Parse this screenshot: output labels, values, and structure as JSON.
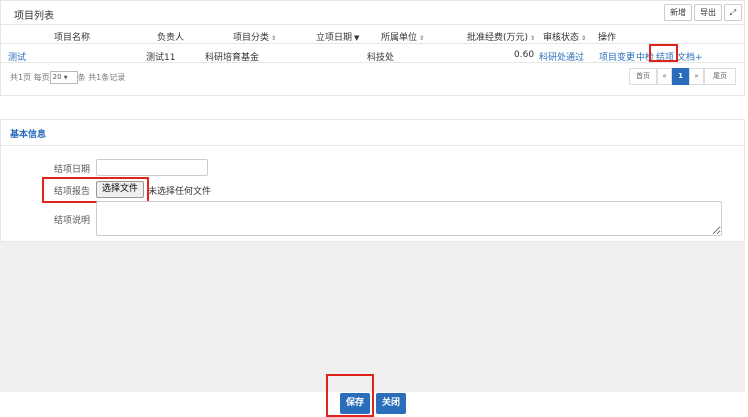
{
  "list": {
    "title": "项目列表",
    "toolbar": {
      "add_label": "新增",
      "export_label": "导出"
    },
    "columns": [
      {
        "label": "项目名称",
        "sortable": false
      },
      {
        "label": "负责人",
        "sortable": false
      },
      {
        "label": "项目分类",
        "sortable": true
      },
      {
        "label": "立项日期",
        "sortable": true,
        "sorted": "desc"
      },
      {
        "label": "所属单位",
        "sortable": true
      },
      {
        "label": "批准经费(万元)",
        "sortable": true
      },
      {
        "label": "审核状态",
        "sortable": true
      },
      {
        "label": "操作",
        "sortable": false
      }
    ],
    "rows": [
      {
        "name": "测试",
        "owner": "测试11",
        "category": "科研培育基金",
        "date": "",
        "unit": "科技处",
        "funding": "0.60",
        "status": "科研处通过",
        "actions": [
          "项目变更",
          "中检",
          "结项",
          "文档+"
        ]
      }
    ],
    "summary": {
      "pages_text": "共1页",
      "per_page_prefix": "每页",
      "per_page_value": "20",
      "per_page_suffix": "条",
      "records_text": "共1条记录"
    },
    "pager": {
      "first": "首页",
      "prev": "«",
      "current": "1",
      "next": "»",
      "last": "尾页"
    }
  },
  "form": {
    "title": "基本信息",
    "date_label": "结项日期",
    "date_value": "",
    "report_label": "结项报告",
    "file_button": "选择文件",
    "file_status": "未选择任何文件",
    "notes_label": "结项说明",
    "notes_value": ""
  },
  "footer": {
    "save_label": "保存",
    "close_label": "关闭"
  },
  "colors": {
    "accent": "#2a6ebb",
    "highlight_box": "#e0241c"
  }
}
